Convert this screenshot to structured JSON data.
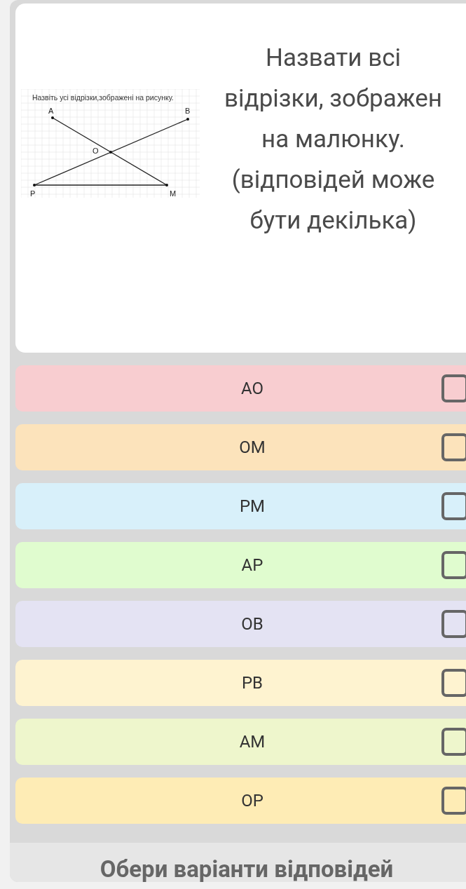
{
  "question": {
    "figure": {
      "caption": "Назвіть усі відрізки,зображені на рисунку.",
      "points": [
        {
          "label": "A"
        },
        {
          "label": "B"
        },
        {
          "label": "O"
        },
        {
          "label": "P"
        },
        {
          "label": "M"
        }
      ]
    },
    "lines": [
      "Назвати всі",
      "відрізки, зображен",
      "на малюнку.",
      "(відповідей може",
      "бути декілька)"
    ]
  },
  "options": [
    {
      "label": "AO",
      "checked": false,
      "color": "#f8cdd0"
    },
    {
      "label": "OM",
      "checked": false,
      "color": "#fce3bb"
    },
    {
      "label": "PM",
      "checked": false,
      "color": "#d8f0fa"
    },
    {
      "label": "AP",
      "checked": false,
      "color": "#e0fccf"
    },
    {
      "label": "OB",
      "checked": false,
      "color": "#e4e3f3"
    },
    {
      "label": "PB",
      "checked": false,
      "color": "#fef3d0"
    },
    {
      "label": "AM",
      "checked": false,
      "color": "#eef6cc"
    },
    {
      "label": "OP",
      "checked": false,
      "color": "#feecb5"
    }
  ],
  "footer": "Обери варіанти відповідей"
}
